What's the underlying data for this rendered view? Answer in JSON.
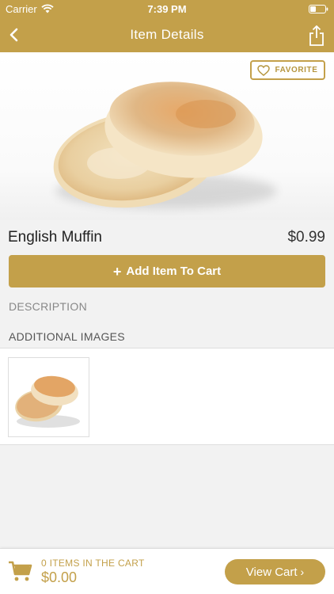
{
  "status_bar": {
    "carrier": "Carrier",
    "time": "7:39 PM"
  },
  "nav": {
    "title": "Item Details",
    "back_icon": "chevron-left-icon",
    "share_icon": "share-icon"
  },
  "product": {
    "favorite_label": "FAVORITE",
    "name": "English Muffin",
    "price": "$0.99",
    "add_to_cart_label": "Add Item To Cart"
  },
  "sections": {
    "description_label": "DESCRIPTION",
    "additional_images_label": "ADDITIONAL IMAGES"
  },
  "cart": {
    "items_label": "0 ITEMS IN THE CART",
    "total": "$0.00",
    "view_cart_label": "View Cart"
  },
  "colors": {
    "accent": "#c3a04a",
    "background": "#f2f2f2"
  }
}
